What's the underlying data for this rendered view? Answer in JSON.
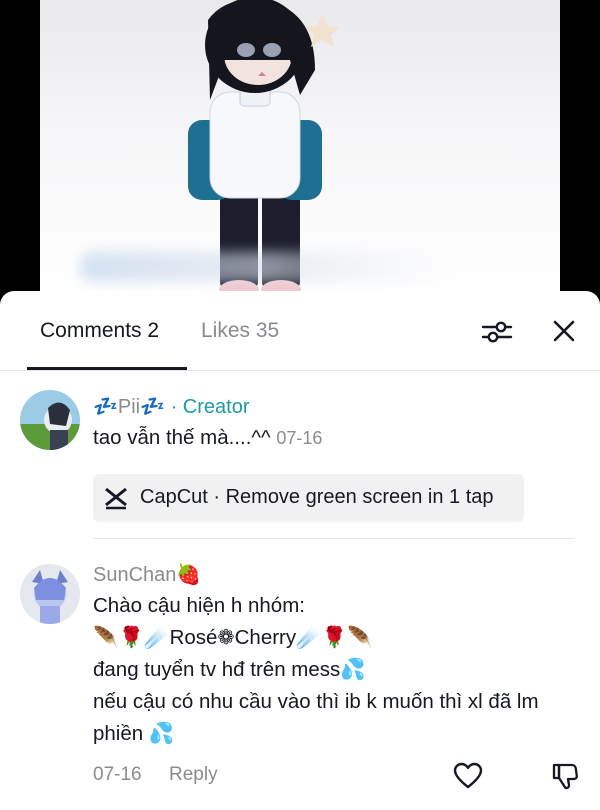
{
  "tabs": {
    "comments_label": "Comments 2",
    "likes_label": "Likes 35"
  },
  "icons": {
    "filter": "sliders-icon",
    "close": "close-icon",
    "like": "heart-icon",
    "dislike": "thumbs-down-icon",
    "capcut": "capcut-logo"
  },
  "comments": [
    {
      "username": "💤Pii💤",
      "creator_label": " · Creator",
      "text": "tao vẫn thế mà....^^",
      "time": "07-16",
      "promo": "CapCut · Remove green screen in 1 tap"
    },
    {
      "username": "SunChan🍓",
      "lines": [
        "Chào cậu hiện h nhóm:",
        "🪶🌹☄️Rosé❁Cherry☄️🌹🪶",
        "đang tuyển tv hđ trên mess💦",
        "nếu cậu có nhu cầu vào thì ib k muốn thì xl đã lm",
        "phiền 💦"
      ],
      "time": "07-16",
      "reply_label": "Reply"
    }
  ],
  "colors": {
    "creator": "#1c9aa8",
    "muted": "#8a8b91",
    "text": "#161823"
  }
}
